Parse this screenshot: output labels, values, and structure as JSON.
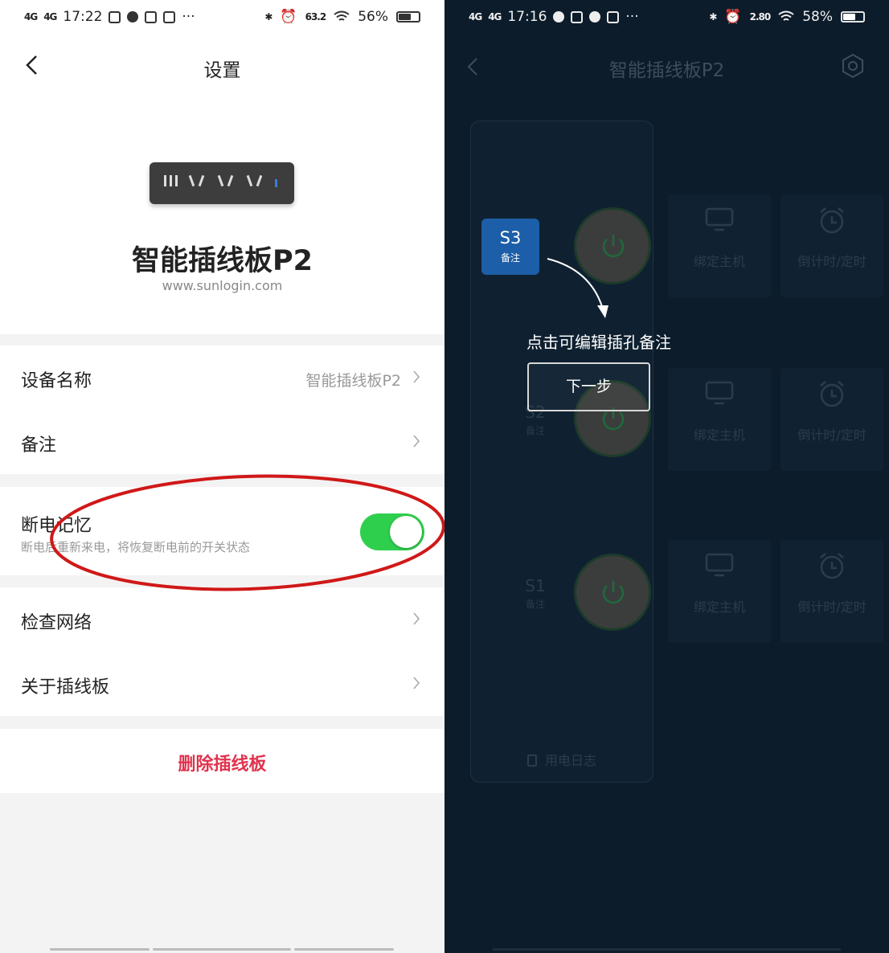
{
  "left": {
    "status": {
      "time": "17:22",
      "signal1": "4G",
      "signal2": "4G",
      "speed": "63.2",
      "battery": "56%",
      "battery_level": 0.56
    },
    "nav": {
      "title": "设置"
    },
    "device": {
      "name": "智能插线板P2",
      "url": "www.sunlogin.com"
    },
    "rows": {
      "device_name": {
        "label": "设备名称",
        "value": "智能插线板P2"
      },
      "remark": {
        "label": "备注"
      },
      "power_memory": {
        "label": "断电记忆",
        "desc": "断电后重新来电，将恢复断电前的开关状态",
        "enabled": true
      },
      "check_network": {
        "label": "检查网络"
      },
      "about": {
        "label": "关于插线板"
      }
    },
    "delete_label": "删除插线板"
  },
  "right": {
    "status": {
      "time": "17:16",
      "signal1": "4G",
      "signal2": "4G",
      "speed": "2.80",
      "battery": "58%",
      "battery_level": 0.58
    },
    "title": "智能插线板P2",
    "sockets": [
      {
        "id": "S3",
        "remark": "备注"
      },
      {
        "id": "S2",
        "remark": "备注"
      },
      {
        "id": "S1",
        "remark": "备注"
      }
    ],
    "tile_labels": {
      "bind": "绑定主机",
      "timer": "倒计时/定时"
    },
    "power_log": "用电日志",
    "guide": {
      "highlight_id": "S3",
      "highlight_remark": "备注",
      "hint": "点击可编辑插孔备注",
      "next": "下一步"
    }
  },
  "colors": {
    "accent_green": "#2fcf4e",
    "danger": "#e0334e",
    "guide_blue": "#1d5ea8",
    "highlight_red": "#d01818"
  },
  "icons": [
    "back-icon",
    "chevron-right-icon",
    "gear-icon",
    "power-icon",
    "monitor-icon",
    "alarm-clock-icon",
    "document-icon",
    "wifi-icon",
    "battery-icon"
  ]
}
